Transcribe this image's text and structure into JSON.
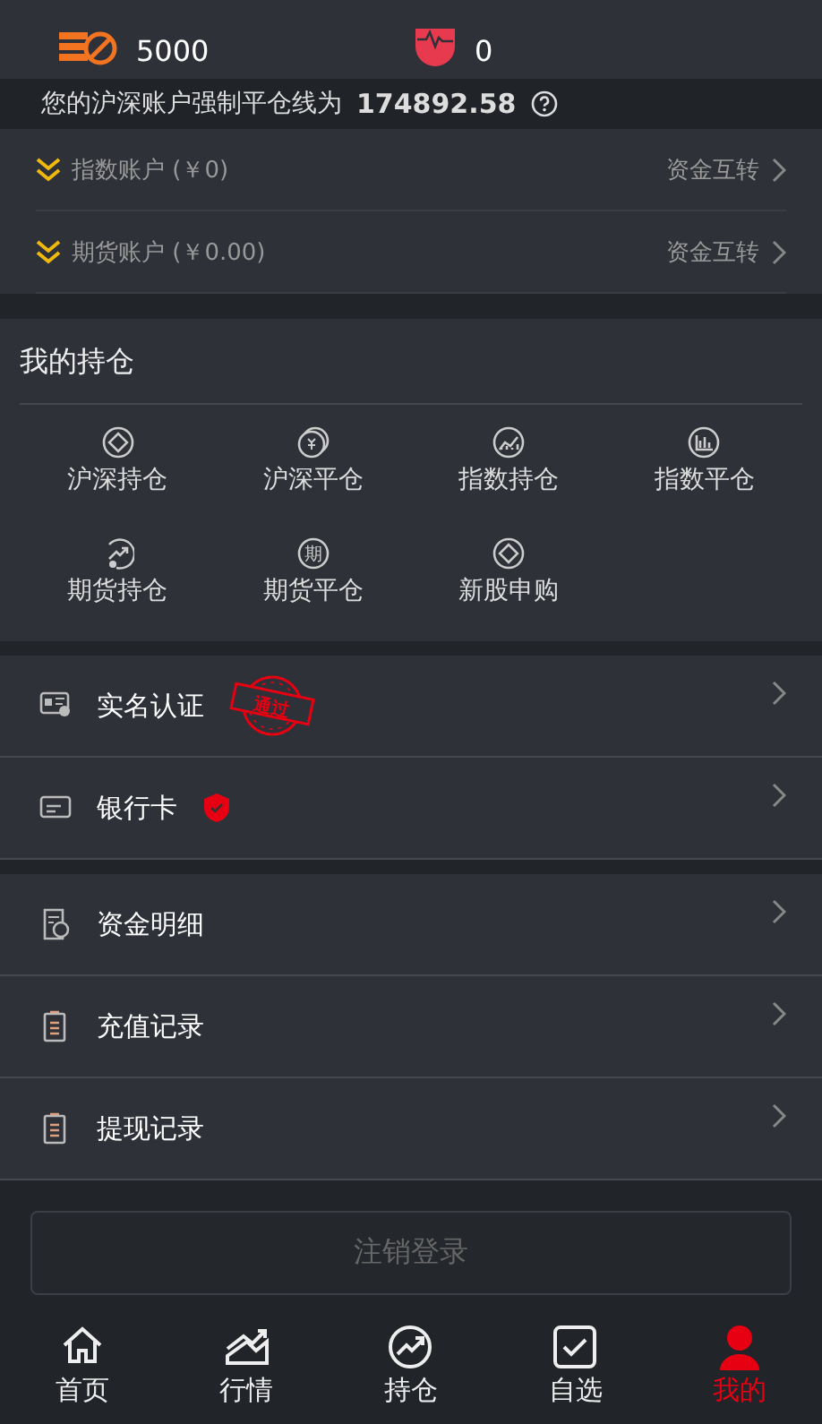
{
  "stats": [
    {
      "kind": "coins",
      "value": "5000"
    },
    {
      "kind": "pulse",
      "value": "0"
    }
  ],
  "liquidation": {
    "label": "您的沪深账户强制平仓线为",
    "amount": "174892.58"
  },
  "accounts": [
    {
      "name": "指数账户 (￥0)",
      "action": "资金互转"
    },
    {
      "name": "期货账户 (￥0.00)",
      "action": "资金互转"
    }
  ],
  "holdings": {
    "title": "我的持仓",
    "items": [
      {
        "kind": "diamond",
        "label": "沪深持仓"
      },
      {
        "kind": "coins",
        "label": "沪深平仓"
      },
      {
        "kind": "chart",
        "label": "指数持仓"
      },
      {
        "kind": "bars",
        "label": "指数平仓"
      },
      {
        "kind": "trend",
        "label": "期货持仓"
      },
      {
        "kind": "qi",
        "label": "期货平仓",
        "glyph": "期"
      },
      {
        "kind": "diamond",
        "label": "新股申购"
      }
    ]
  },
  "menu_groups": [
    [
      {
        "kind": "id",
        "label": "实名认证",
        "stamp": "通过"
      },
      {
        "kind": "card",
        "label": "银行卡",
        "verified": true
      }
    ],
    [
      {
        "kind": "funds",
        "label": "资金明细"
      },
      {
        "kind": "doc",
        "label": "充值记录"
      },
      {
        "kind": "doc",
        "label": "提现记录"
      }
    ]
  ],
  "logout": "注销登录",
  "tabs": [
    {
      "kind": "home",
      "label": "首页",
      "selected": false
    },
    {
      "kind": "market",
      "label": "行情",
      "selected": false
    },
    {
      "kind": "hold",
      "label": "持仓",
      "selected": false
    },
    {
      "kind": "watch",
      "label": "自选",
      "selected": false
    },
    {
      "kind": "me",
      "label": "我的",
      "selected": true
    }
  ]
}
